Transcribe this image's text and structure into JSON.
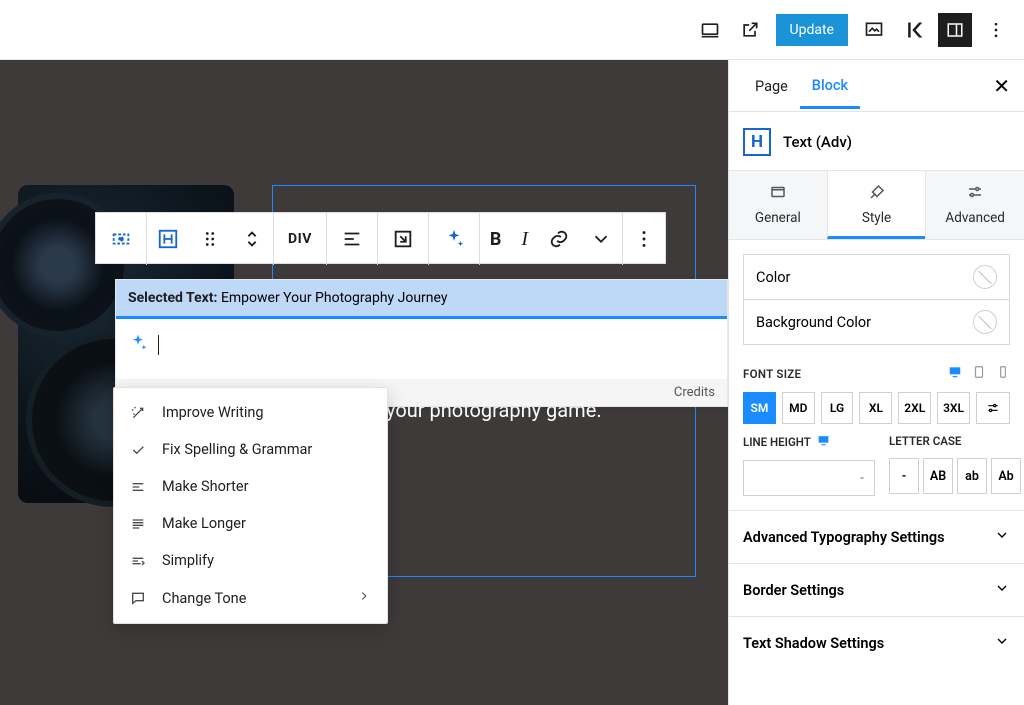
{
  "topbar": {
    "update": "Update"
  },
  "canvas": {
    "behind_text": "your photography game."
  },
  "ai": {
    "selected_prefix": "Selected Text:",
    "selected_value": "Empower Your Photography Journey",
    "credits": "Credits",
    "menu": {
      "improve": "Improve Writing",
      "fix": "Fix Spelling & Grammar",
      "shorter": "Make Shorter",
      "longer": "Make Longer",
      "simplify": "Simplify",
      "tone": "Change Tone"
    }
  },
  "toolbar": {
    "div": "DIV"
  },
  "sidebar": {
    "tabs": {
      "page": "Page",
      "block": "Block"
    },
    "block_title": "Text (Adv)",
    "subtabs": {
      "general": "General",
      "style": "Style",
      "advanced": "Advanced"
    },
    "color": "Color",
    "bg_color": "Background Color",
    "font_size_label": "FONT SIZE",
    "sizes": {
      "sm": "SM",
      "md": "MD",
      "lg": "LG",
      "xl": "XL",
      "xl2": "2XL",
      "xl3": "3XL"
    },
    "line_height_label": "LINE HEIGHT",
    "line_height_placeholder": "-",
    "letter_case_label": "LETTER CASE",
    "cases": {
      "none": "-",
      "upper": "AB",
      "lower": "ab",
      "cap": "Ab"
    },
    "sections": {
      "typo": "Advanced Typography Settings",
      "border": "Border Settings",
      "shadow": "Text Shadow Settings"
    }
  }
}
